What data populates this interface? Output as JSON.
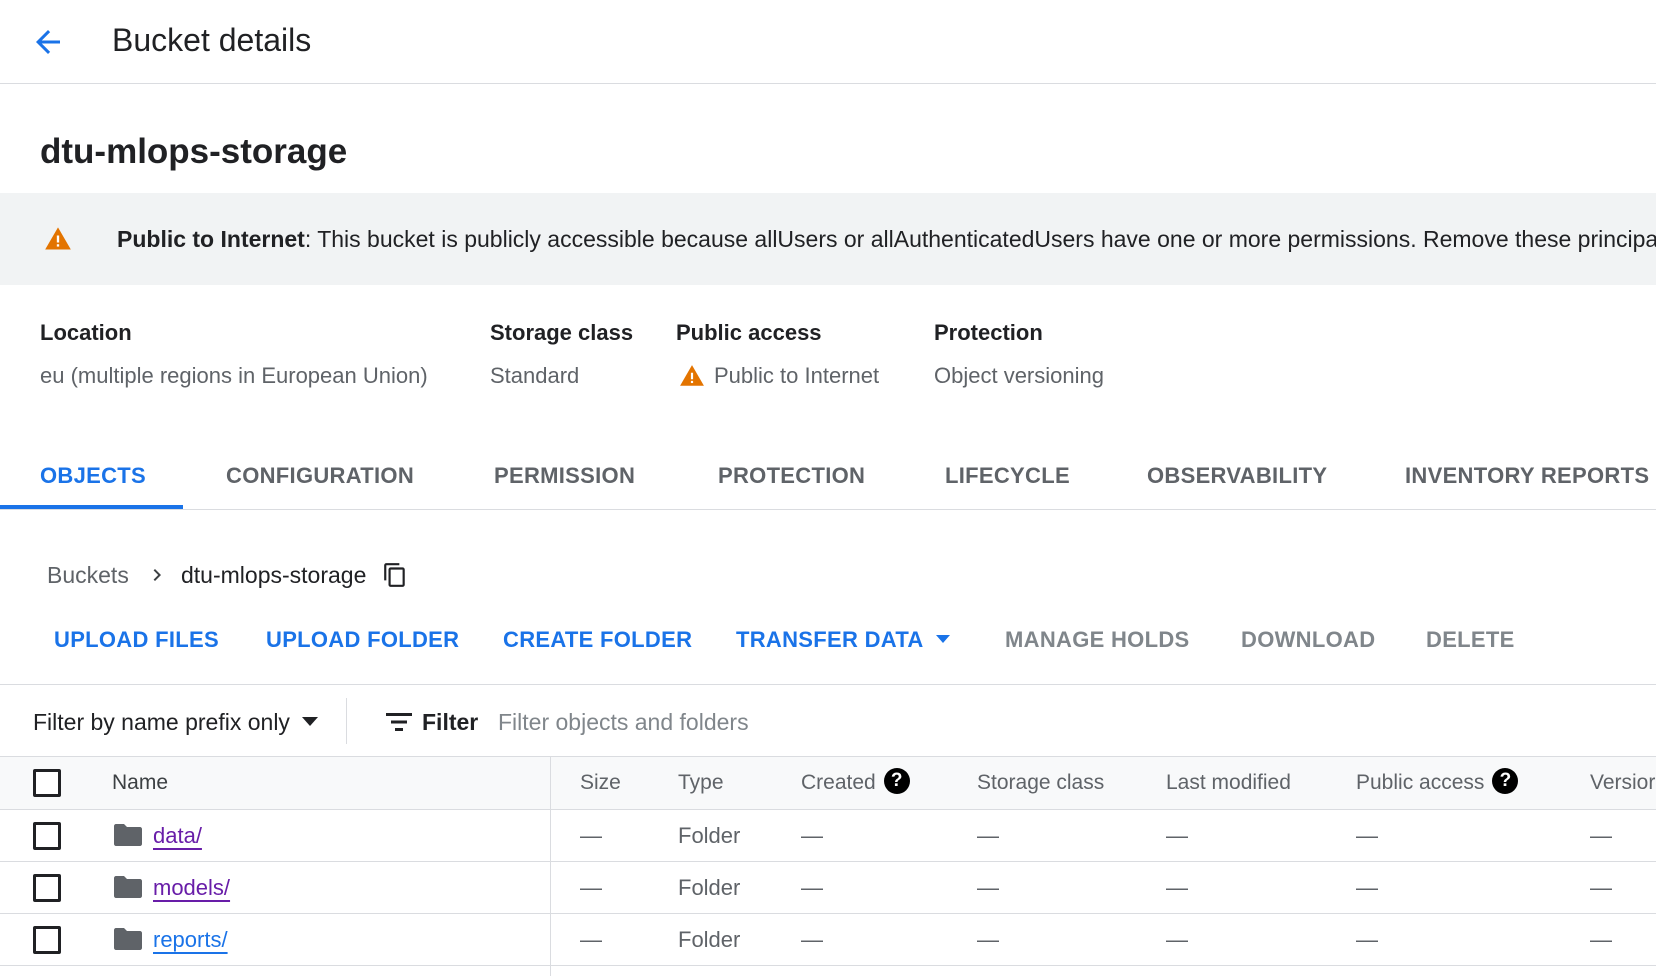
{
  "header": {
    "title": "Bucket details",
    "back_icon": "arrow-back-icon"
  },
  "bucket": {
    "name": "dtu-mlops-storage"
  },
  "banner": {
    "icon": "warning-icon",
    "title": "Public to Internet",
    "message": ": This bucket is publicly accessible because allUsers or allAuthenticatedUsers have one or more permissions. Remove these principa"
  },
  "summary": {
    "location": {
      "label": "Location",
      "value": "eu (multiple regions in European Union)"
    },
    "storage_class": {
      "label": "Storage class",
      "value": "Standard"
    },
    "public_access": {
      "label": "Public access",
      "value": "Public to Internet"
    },
    "protection": {
      "label": "Protection",
      "value": "Object versioning"
    }
  },
  "tabs": [
    {
      "label": "OBJECTS",
      "active": true
    },
    {
      "label": "CONFIGURATION",
      "active": false
    },
    {
      "label": "PERMISSION",
      "active": false
    },
    {
      "label": "PROTECTION",
      "active": false
    },
    {
      "label": "LIFECYCLE",
      "active": false
    },
    {
      "label": "OBSERVABILITY",
      "active": false
    },
    {
      "label": "INVENTORY REPORTS",
      "active": false
    }
  ],
  "breadcrumb": {
    "root": "Buckets",
    "current": "dtu-mlops-storage"
  },
  "actions": {
    "upload_files": "UPLOAD FILES",
    "upload_folder": "UPLOAD FOLDER",
    "create_folder": "CREATE FOLDER",
    "transfer_data": "TRANSFER DATA",
    "manage_holds": "MANAGE HOLDS",
    "download": "DOWNLOAD",
    "delete": "DELETE"
  },
  "filter": {
    "mode": "Filter by name prefix only",
    "label": "Filter",
    "placeholder": "Filter objects and folders"
  },
  "table": {
    "columns": {
      "name": "Name",
      "size": "Size",
      "type": "Type",
      "created": "Created",
      "storage_class": "Storage class",
      "last_modified": "Last modified",
      "public_access": "Public access",
      "version": "Versior"
    },
    "help_glyph": "?",
    "rows": [
      {
        "name": "data/",
        "size": "—",
        "type": "Folder",
        "created": "—",
        "storage_class": "—",
        "last_modified": "—",
        "public_access": "—",
        "version": "—",
        "visited": true
      },
      {
        "name": "models/",
        "size": "—",
        "type": "Folder",
        "created": "—",
        "storage_class": "—",
        "last_modified": "—",
        "public_access": "—",
        "version": "—",
        "visited": true
      },
      {
        "name": "reports/",
        "size": "—",
        "type": "Folder",
        "created": "—",
        "storage_class": "—",
        "last_modified": "—",
        "public_access": "—",
        "version": "—",
        "visited": false
      }
    ]
  },
  "colors": {
    "accent": "#1a73e8",
    "warning": "#e37400",
    "visited_link": "#681da8",
    "muted_text": "#5f6368"
  }
}
